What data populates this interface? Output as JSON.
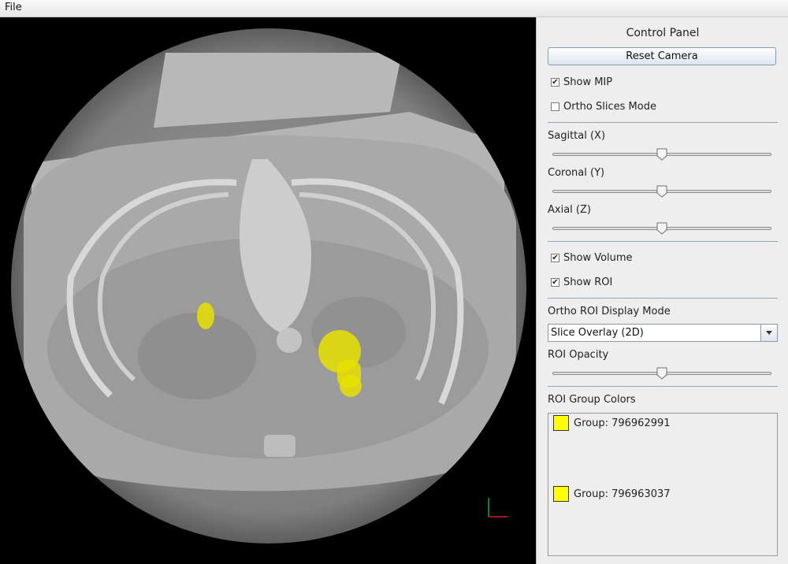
{
  "menubar": {
    "file_label": "File"
  },
  "viewport": {
    "roi_color": "#e6e000"
  },
  "panel": {
    "title": "Control Panel",
    "reset_camera_label": "Reset Camera",
    "show_mip": {
      "label": "Show MIP",
      "checked": true
    },
    "ortho_slices": {
      "label": "Ortho Slices Mode",
      "checked": false
    },
    "sagittal": {
      "label": "Sagittal (X)",
      "value_fraction": 0.5
    },
    "coronal": {
      "label": "Coronal (Y)",
      "value_fraction": 0.5
    },
    "axial": {
      "label": "Axial (Z)",
      "value_fraction": 0.5
    },
    "show_volume": {
      "label": "Show Volume",
      "checked": true
    },
    "show_roi": {
      "label": "Show ROI",
      "checked": true
    },
    "ortho_roi_mode_label": "Ortho ROI Display Mode",
    "ortho_roi_mode_value": "Slice Overlay (2D)",
    "roi_opacity": {
      "label": "ROI Opacity",
      "value_fraction": 0.5
    },
    "roi_group_colors_label": "ROI Group Colors",
    "groups": [
      {
        "label": "Group: 796962991",
        "color": "#ffff00"
      },
      {
        "label": "Group: 796963037",
        "color": "#ffff00"
      }
    ]
  }
}
